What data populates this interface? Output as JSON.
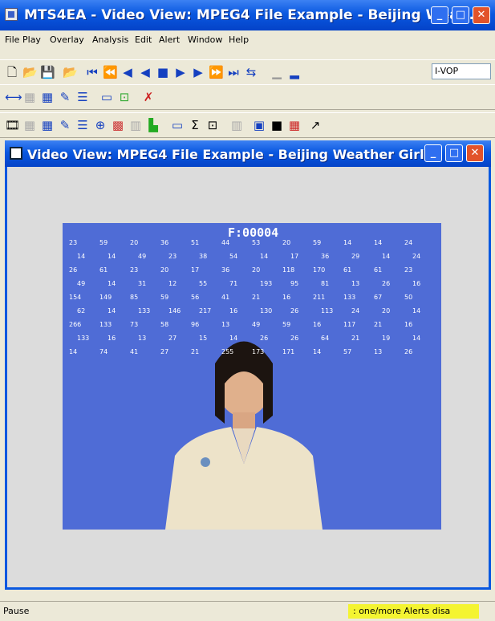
{
  "window": {
    "title": "MTS4EA - Video View: MPEG4 File Example - Beijing Wea..."
  },
  "menu": [
    "File",
    "Play",
    "Overlay",
    "Analysis",
    "Edit",
    "Alert",
    "Window",
    "Help"
  ],
  "toolbar": {
    "vop_type": "I-VOP"
  },
  "video_window": {
    "title": "Video View: MPEG4 File Example - Beijing Weather Girl"
  },
  "video": {
    "frame_counter": "F:00004",
    "overlay_numbers": [
      "23",
      "59",
      "20",
      "36",
      "51",
      "44",
      "53",
      "20",
      "59",
      "14",
      "14",
      "24",
      "14",
      "14",
      "49",
      "23",
      "38",
      "54",
      "14",
      "17",
      "36",
      "29",
      "14",
      "24",
      "26",
      "61",
      "23",
      "20",
      "17",
      "36",
      "20",
      "118",
      "170",
      "61",
      "61",
      "23",
      "49",
      "14",
      "31",
      "12",
      "55",
      "71",
      "193",
      "95",
      "81",
      "13",
      "26",
      "16",
      "154",
      "149",
      "85",
      "59",
      "56",
      "41",
      "21",
      "16",
      "211",
      "133",
      "67",
      "50",
      "62",
      "14",
      "133",
      "146",
      "217",
      "16",
      "130",
      "26",
      "113",
      "24",
      "20",
      "14",
      "266",
      "133",
      "73",
      "58",
      "96",
      "13",
      "49",
      "59",
      "16",
      "117",
      "21",
      "16",
      "133",
      "16",
      "13",
      "27",
      "15",
      "14",
      "26",
      "26",
      "64",
      "21",
      "19",
      "14",
      "14",
      "74",
      "41",
      "27",
      "21",
      "255",
      "173",
      "171",
      "14",
      "57",
      "13",
      "26"
    ]
  },
  "status": {
    "left": "Pause",
    "right": ": one/more Alerts disa"
  }
}
